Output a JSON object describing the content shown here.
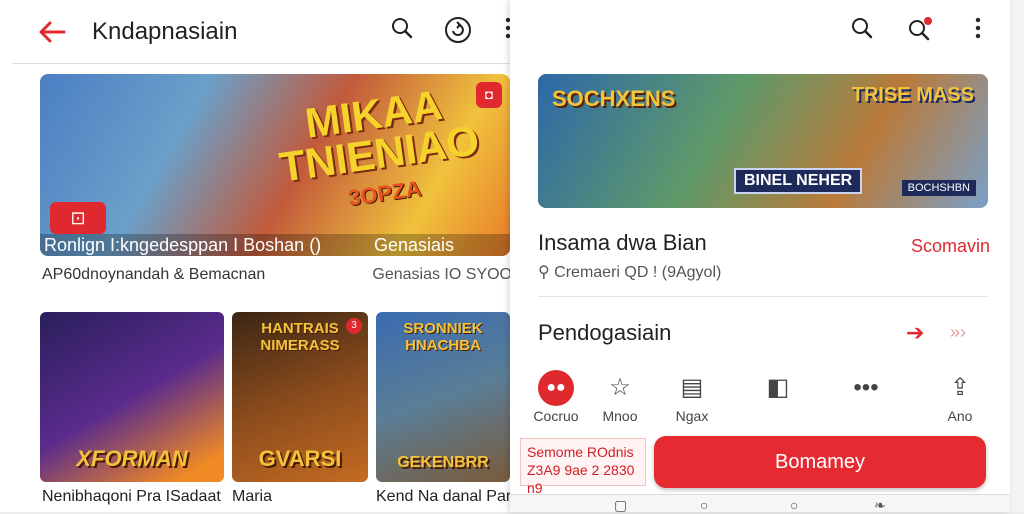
{
  "left": {
    "app_title": "Kndapnasiain",
    "hero": {
      "text_top": "MIKAA",
      "text_main": "TNIENIAO",
      "text_sub": "3OPZA",
      "badge": "⊡",
      "caption": "Ronlign I:kngedesppan I Boshan ()",
      "caption_tag": "Genasiais",
      "meta_left": "AP60dnoynandah & Bemacnan",
      "meta_right": "Genasias IO SYOO"
    },
    "thumbs": [
      {
        "top": "",
        "title": "XFORMAN",
        "label": "Nenibhaqoni Pra ISadaat"
      },
      {
        "top": "HANTRAIS NIMERASS",
        "title": "GVARSI",
        "num": "3",
        "label": "Maria"
      },
      {
        "top": "SRONNIEK HNACHBA",
        "title": "GEKENBRR",
        "label": "Kend Na danal Par"
      }
    ]
  },
  "right": {
    "hero": {
      "left_title": "SOCHXENS",
      "right_title": "TRISE MASS",
      "mid_label": "BINEL NEHER",
      "bottom_badge": "BOCHSHBN"
    },
    "title": "Insama dwa Bian",
    "link": "Scomavin",
    "subtitle": "Cremaeri QD ! (9Agyol)",
    "section": "Pendogasiain",
    "actions": [
      {
        "label": "Cocruo",
        "icon": "record-icon"
      },
      {
        "label": "Mnoo",
        "icon": "star-icon"
      },
      {
        "label": "Ngax",
        "icon": "card-icon"
      },
      {
        "label": "",
        "icon": "tag-icon"
      },
      {
        "label": "",
        "icon": "more-icon"
      },
      {
        "label": "Ano",
        "icon": "share-icon"
      }
    ],
    "promo_line1": "Semome ROdnis",
    "promo_line2": "Z3A9 9ae 2 2830 n9",
    "buy_label": "Bomamey"
  }
}
